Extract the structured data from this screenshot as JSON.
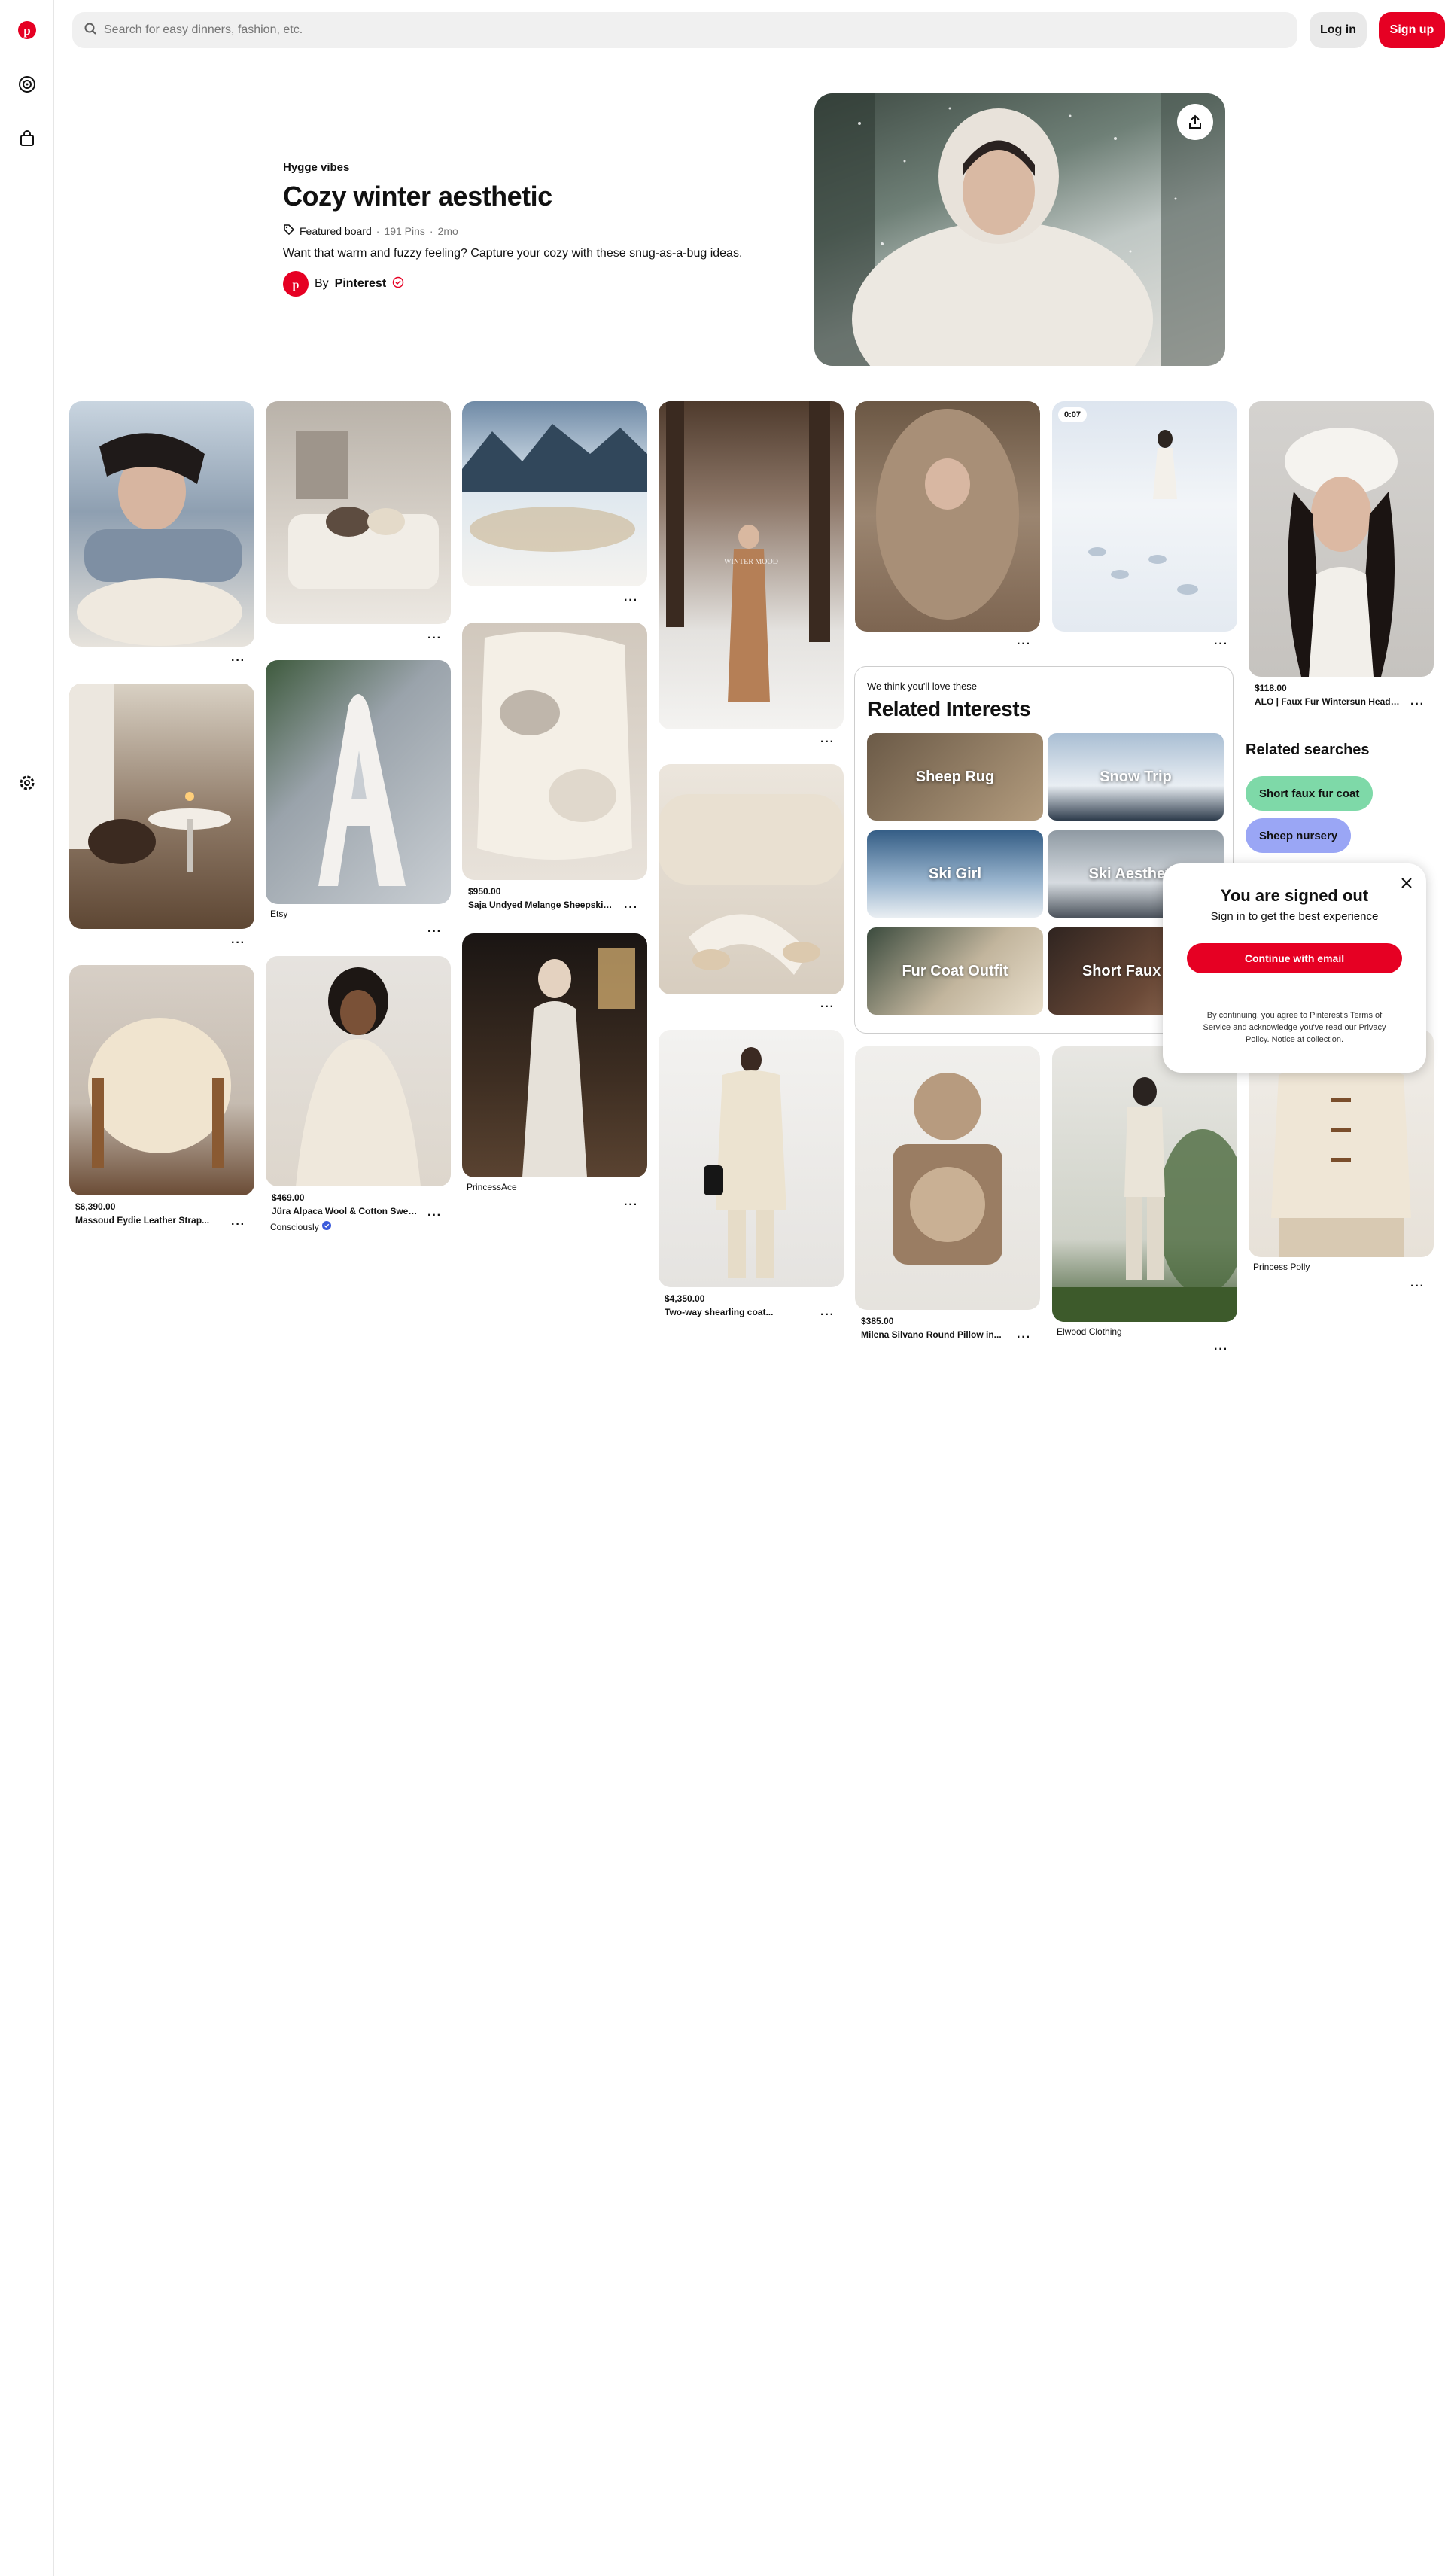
{
  "search": {
    "placeholder": "Search for easy dinners, fashion, etc."
  },
  "header": {
    "login_label": "Log in",
    "signup_label": "Sign up"
  },
  "board": {
    "kicker": "Hygge vibes",
    "title": "Cozy winter aesthetic",
    "tag": "Featured board",
    "pins": "191 Pins",
    "age": "2mo",
    "sep": "·",
    "description": "Want that warm and fuzzy feeling? Capture your cozy with these snug-as-a-bug ideas.",
    "by_prefix": "By",
    "owner": "Pinterest"
  },
  "pins": [
    {
      "id": "p1",
      "price": "",
      "title": "",
      "source": ""
    },
    {
      "id": "p2",
      "price": "",
      "title": "",
      "source": ""
    },
    {
      "id": "p3",
      "price": "",
      "title": "",
      "source": ""
    },
    {
      "id": "p4",
      "price": "",
      "title": "",
      "source": ""
    },
    {
      "id": "p5",
      "price": "",
      "title": "",
      "source": ""
    },
    {
      "id": "p6",
      "price": "",
      "title": "",
      "source": "",
      "video_time": "0:07"
    },
    {
      "id": "p7",
      "price": "$118.00",
      "title": "ALO | Faux Fur Wintersun Headban...",
      "source": ""
    },
    {
      "id": "p8",
      "price": "",
      "title": "",
      "source": ""
    },
    {
      "id": "p9",
      "price": "",
      "title": "",
      "source": "Etsy"
    },
    {
      "id": "p10",
      "price": "$950.00",
      "title": "Saja Undyed Melange Sheepskin...",
      "source": ""
    },
    {
      "id": "p11",
      "price": "",
      "title": "",
      "source": ""
    },
    {
      "id": "p12",
      "price": "$6,390.00",
      "title": "Massoud Eydie Leather Strap...",
      "source": ""
    },
    {
      "id": "p13",
      "price": "$469.00",
      "title": "Jüra Alpaca Wool & Cotton Sweate...",
      "source": "Consciously"
    },
    {
      "id": "p14",
      "price": "",
      "title": "",
      "source": "PrincessAce"
    },
    {
      "id": "p15",
      "price": "$4,350.00",
      "title": "Two-way shearling coat...",
      "source": ""
    },
    {
      "id": "p16",
      "price": "$385.00",
      "title": "Milena Silvano Round Pillow in...",
      "source": ""
    },
    {
      "id": "p17",
      "price": "",
      "title": "",
      "source": "Elwood Clothing"
    },
    {
      "id": "p18",
      "price": "",
      "title": "",
      "source": "Princess Polly"
    }
  ],
  "more_label": "···",
  "related_interests": {
    "kicker": "We think you'll love these",
    "title": "Related Interests",
    "items": [
      "Sheep Rug",
      "Snow Trip",
      "Ski Girl",
      "Ski Aesthetic",
      "Fur Coat Outfit",
      "Short Faux Fur"
    ]
  },
  "related_searches": {
    "title": "Related searches",
    "items": [
      "Short faux fur coat",
      "Sheep nursery"
    ]
  },
  "modal": {
    "title": "You are signed out",
    "subtitle": "Sign in to get the best experience",
    "button": "Continue with email",
    "legal_pre": "By continuing, you agree to Pinterest's ",
    "terms": "Terms of Service",
    "legal_mid": " and acknowledge you've read our ",
    "privacy": "Privacy Policy",
    "legal_sep": ". ",
    "notice": "Notice at collection",
    "legal_end": "."
  },
  "colors": {
    "brand": "#e60023",
    "chip_green": "#7ed9a8",
    "chip_blue": "#9aa6f5",
    "verified": "#3b5bdb"
  },
  "icons": [
    "pinterest-logo-icon",
    "explore-icon",
    "shop-icon",
    "settings-icon",
    "search-icon",
    "share-icon",
    "close-icon",
    "tag-icon",
    "verified-icon"
  ]
}
